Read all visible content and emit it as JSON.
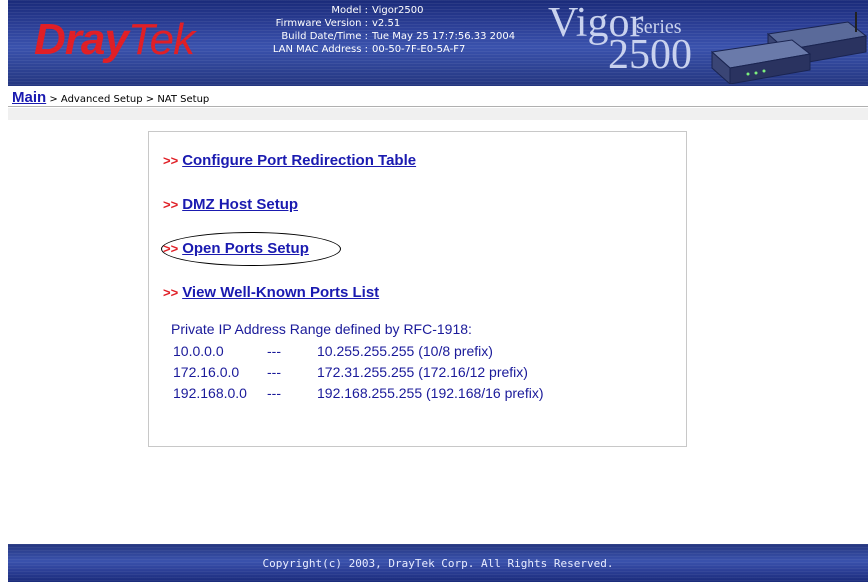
{
  "header": {
    "logo_part1": "Dray",
    "logo_part2": "Tek",
    "brand_vigor": "Vigor",
    "brand_series": "series",
    "brand_model": "2500",
    "info": [
      {
        "label": "Model :",
        "value": "Vigor2500"
      },
      {
        "label": "Firmware Version :",
        "value": "v2.51"
      },
      {
        "label": "Build Date/Time :",
        "value": "Tue May 25 17:7:56.33 2004"
      },
      {
        "label": "LAN MAC Address :",
        "value": "00-50-7F-E0-5A-F7"
      }
    ]
  },
  "breadcrumb": {
    "main": "Main",
    "rest": " > Advanced Setup > NAT Setup"
  },
  "links": [
    {
      "arrow": ">>",
      "label": "Configure Port Redirection Table"
    },
    {
      "arrow": ">>",
      "label": "DMZ Host Setup"
    },
    {
      "arrow": ">>",
      "label": "Open Ports Setup"
    },
    {
      "arrow": ">>",
      "label": "View Well-Known Ports List"
    }
  ],
  "private_ip": {
    "title": "Private IP Address Range defined by RFC-1918:",
    "rows": [
      {
        "start": "10.0.0.0",
        "sep": "---",
        "end": "10.255.255.255  (10/8 prefix)"
      },
      {
        "start": "172.16.0.0",
        "sep": "---",
        "end": "172.31.255.255  (172.16/12 prefix)"
      },
      {
        "start": "192.168.0.0",
        "sep": "---",
        "end": "192.168.255.255 (192.168/16 prefix)"
      }
    ]
  },
  "footer": {
    "copyright": "Copyright(c) 2003, DrayTek Corp. All Rights Reserved."
  },
  "colors": {
    "header_blue": "#2c3f96",
    "link_blue": "#1a1ab0",
    "arrow_red": "#e01f26",
    "text_blue": "#1a1a9a"
  }
}
